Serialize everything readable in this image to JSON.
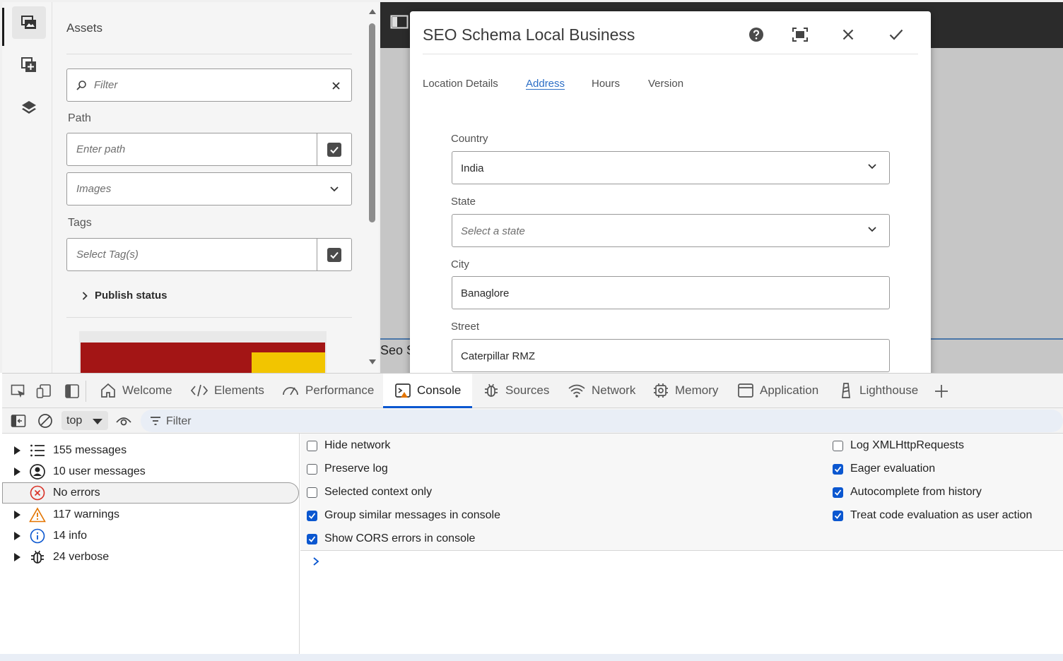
{
  "assets_panel": {
    "title": "Assets",
    "filter_placeholder": "Filter",
    "path_label": "Path",
    "path_placeholder": "Enter path",
    "type_placeholder": "Images",
    "tags_label": "Tags",
    "tags_placeholder": "Select Tag(s)",
    "publish_status_label": "Publish status"
  },
  "editor": {
    "page_label": "Seo S"
  },
  "dialog": {
    "title": "SEO Schema Local Business",
    "tabs": [
      "Location Details",
      "Address",
      "Hours",
      "Version"
    ],
    "active_tab": "Address",
    "country_label": "Country",
    "country_value": "India",
    "state_label": "State",
    "state_placeholder": "Select a state",
    "city_label": "City",
    "city_value": "Banaglore",
    "street_label": "Street",
    "street_value": "Caterpillar RMZ"
  },
  "devtools": {
    "tabs": [
      "Welcome",
      "Elements",
      "Performance",
      "Console",
      "Sources",
      "Network",
      "Memory",
      "Application",
      "Lighthouse"
    ],
    "active_tab": "Console",
    "context": "top",
    "filter_placeholder": "Filter",
    "sidebar": [
      {
        "label": "155 messages",
        "icon": "list-icon"
      },
      {
        "label": "10 user messages",
        "icon": "user-icon"
      },
      {
        "label": "No errors",
        "icon": "error-icon"
      },
      {
        "label": "117 warnings",
        "icon": "warning-icon"
      },
      {
        "label": "14 info",
        "icon": "info-icon"
      },
      {
        "label": "24 verbose",
        "icon": "bug-icon"
      }
    ],
    "settings_left": [
      {
        "label": "Hide network",
        "checked": false
      },
      {
        "label": "Preserve log",
        "checked": false
      },
      {
        "label": "Selected context only",
        "checked": false
      },
      {
        "label": "Group similar messages in console",
        "checked": true
      },
      {
        "label": "Show CORS errors in console",
        "checked": true
      }
    ],
    "settings_right": [
      {
        "label": "Log XMLHttpRequests",
        "checked": false
      },
      {
        "label": "Eager evaluation",
        "checked": true
      },
      {
        "label": "Autocomplete from history",
        "checked": true
      },
      {
        "label": "Treat code evaluation as user action",
        "checked": true
      }
    ]
  },
  "colors": {
    "accent": "#0b57d0",
    "dialog_tab_active": "#2c6ec6",
    "warning": "#e37400",
    "error": "#d93025"
  }
}
